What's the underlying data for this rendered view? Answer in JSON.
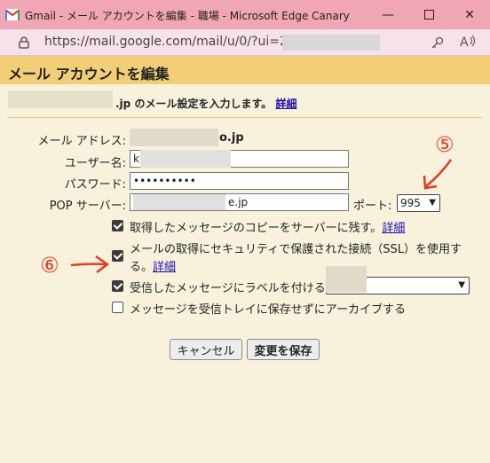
{
  "window": {
    "title": "Gmail - メール アカウントを編集 - 職場 - Microsoft Edge Canary",
    "url": "https://mail.google.com/mail/u/0/?ui=2&ik=                    er=D-"
  },
  "page": {
    "title": "メール アカウントを編集",
    "description": ".jp のメール設定を入力します。",
    "details_link": "詳細"
  },
  "form": {
    "email_label": "メール アドレス:",
    "email_value": "o.jp",
    "username_label": "ユーザー名:",
    "username_value": "k            co.jp",
    "password_label": "パスワード:",
    "password_value": "••••••••••",
    "pop_label": "POP サーバー:",
    "pop_value": "e.jp",
    "port_label": "ポート:",
    "port_value": "995"
  },
  "options": [
    {
      "label": "取得したメッセージのコピーをサーバーに残す。",
      "link": "詳細",
      "checked": true
    },
    {
      "label": "メールの取得にセキュリティで保護された接続（SSL）を使用す",
      "label2": "る。",
      "link": "詳細",
      "checked": true
    },
    {
      "label": "受信したメッセージにラベルを付ける:",
      "checked": true
    },
    {
      "label": "メッセージを受信トレイに保存せずにアーカイブする",
      "checked": false
    }
  ],
  "buttons": {
    "cancel": "キャンセル",
    "save": "変更を保存"
  },
  "annotations": {
    "five": "⑤",
    "six": "⑥"
  },
  "colors": {
    "titlebar": "#f0a6b4",
    "header": "#f2ce77",
    "annotation": "#e53a25"
  }
}
